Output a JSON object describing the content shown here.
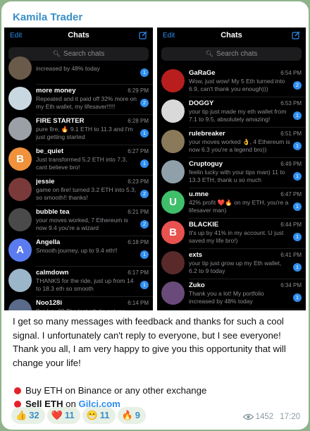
{
  "channel": {
    "sender": "Kamila Trader"
  },
  "left_panel": {
    "edit_label": "Edit",
    "title": "Chats",
    "search_placeholder": "Search chats",
    "chats": [
      {
        "name": "",
        "time": "",
        "message": "increased by 48% today",
        "badge": "1",
        "avatar_letter": "",
        "avatar_color": "#6a5a4a"
      },
      {
        "name": "more money",
        "time": "6:29 PM",
        "message": "Repeated and it paid off 32% more on my Eth wallet, my lifesaver!!!!!",
        "badge": "2",
        "avatar_letter": "",
        "avatar_color": "#c9d7e0"
      },
      {
        "name": "FIRE STARTER",
        "time": "6:28 PM",
        "message": "pure fire, 🔥 9.1 ETH to 11.3 and I'm just getting started",
        "badge": "1",
        "avatar_letter": "",
        "avatar_color": "#9aa0a6"
      },
      {
        "name": "be_quiet",
        "time": "6:27 PM",
        "message": "Just transformed 5.2 ETH into 7.3, cant believe bro!",
        "badge": "1",
        "avatar_letter": "B",
        "avatar_color": "#f0913b"
      },
      {
        "name": "jessie",
        "time": "6:23 PM",
        "message": "game on fire! turned 3.2 ETH into 5.3, so smooth!! thanks!",
        "badge": "2",
        "avatar_letter": "",
        "avatar_color": "#7a3a3a"
      },
      {
        "name": "bubble tea",
        "time": "6:21 PM",
        "message": "your moves worked, 7 Ethereum is now 9.4 you're a wizard",
        "badge": "2",
        "avatar_letter": "",
        "avatar_color": "#4a4a4a"
      },
      {
        "name": "Angella",
        "time": "6:18 PM",
        "message": "Smooth journey, up to 9.4 eth!!",
        "badge": "1",
        "avatar_letter": "A",
        "avatar_color": "#5b7cf0"
      },
      {
        "name": "calmdown",
        "time": "6:17 PM",
        "message": "THANKS for the ride, just up from 14 to 18.3 eth so smooth",
        "badge": "1",
        "avatar_letter": "",
        "avatar_color": "#9bb5c9"
      },
      {
        "name": "Noo128i",
        "time": "6:14 PM",
        "message": "Bro how?? The last eth tip got me",
        "badge": "",
        "avatar_letter": "",
        "avatar_color": "#5a6a8a"
      }
    ]
  },
  "right_panel": {
    "edit_label": "Edit",
    "title": "Chats",
    "search_placeholder": "Search chats",
    "chats": [
      {
        "name": "GaRaGe",
        "time": "6:54 PM",
        "message": "Wow, just wow! My 5 Eth turned into 6.9, can't thank you enough)))",
        "badge": "2",
        "avatar_letter": "",
        "avatar_color": "#b81e1e"
      },
      {
        "name": "DOGGY",
        "time": "6:53 PM",
        "message": "your tip just made my eth wallet from 7.1 to 9.5, absolutely amazing!",
        "badge": "1",
        "avatar_letter": "",
        "avatar_color": "#d9d9d9"
      },
      {
        "name": "rulebreaker",
        "time": "6:51 PM",
        "message": "your moves worked 👌, 4 Ethereum is now 6.3 you're a legend bro))",
        "badge": "1",
        "avatar_letter": "",
        "avatar_color": "#8a7a5a"
      },
      {
        "name": "Cruptoguy",
        "time": "6:49 PM",
        "message": "feelin lucky with your tips man) 11 to 13.3 ETH, thank u so much",
        "badge": "1",
        "avatar_letter": "",
        "avatar_color": "#8fa0aa"
      },
      {
        "name": "u.mne",
        "time": "6:47 PM",
        "message": "42% profit ❤️🔥 on my ETH, you're a lifesaver man)",
        "badge": "1",
        "avatar_letter": "U",
        "avatar_color": "#3fbf6a"
      },
      {
        "name": "BLACKIE",
        "time": "6:44 PM",
        "message": "It's up by 41% in my account. U just saved my life bro!)",
        "badge": "1",
        "avatar_letter": "B",
        "avatar_color": "#e8524f"
      },
      {
        "name": "exts",
        "time": "6:41 PM",
        "message": "your tip just grow up my Eth wallet, 6.2 to 9 today",
        "badge": "1",
        "avatar_letter": "",
        "avatar_color": "#5a2a2a"
      },
      {
        "name": "Zuko",
        "time": "6:34 PM",
        "message": "Thank you a lot! My portfolio increased by 48% today",
        "badge": "1",
        "avatar_letter": "",
        "avatar_color": "#6a4a7a"
      }
    ]
  },
  "post": {
    "paragraph": "I get so many messages with feedback and thanks for such a cool signal. I unfortunately can't reply to everyone, but I see everyone! Thank you all, I am very happy to give you this opportunity that will change your life!",
    "bullet1": "Buy ETH on Binance or any other exchange",
    "bullet2_bold": "Sell ETH",
    "bullet2_mid": " on ",
    "bullet2_link": "Gilci.com"
  },
  "reactions": [
    {
      "emoji": "👍",
      "count": "32"
    },
    {
      "emoji": "❤️",
      "count": "11"
    },
    {
      "emoji": "😁",
      "count": "11"
    },
    {
      "emoji": "🔥",
      "count": "9"
    }
  ],
  "meta": {
    "views": "1452",
    "time": "17:20"
  },
  "colors": {
    "accent": "#2f8ef0",
    "sender": "#3a8fc7",
    "bullet": "#e4212a",
    "chat_bg": "#8fb38a"
  }
}
